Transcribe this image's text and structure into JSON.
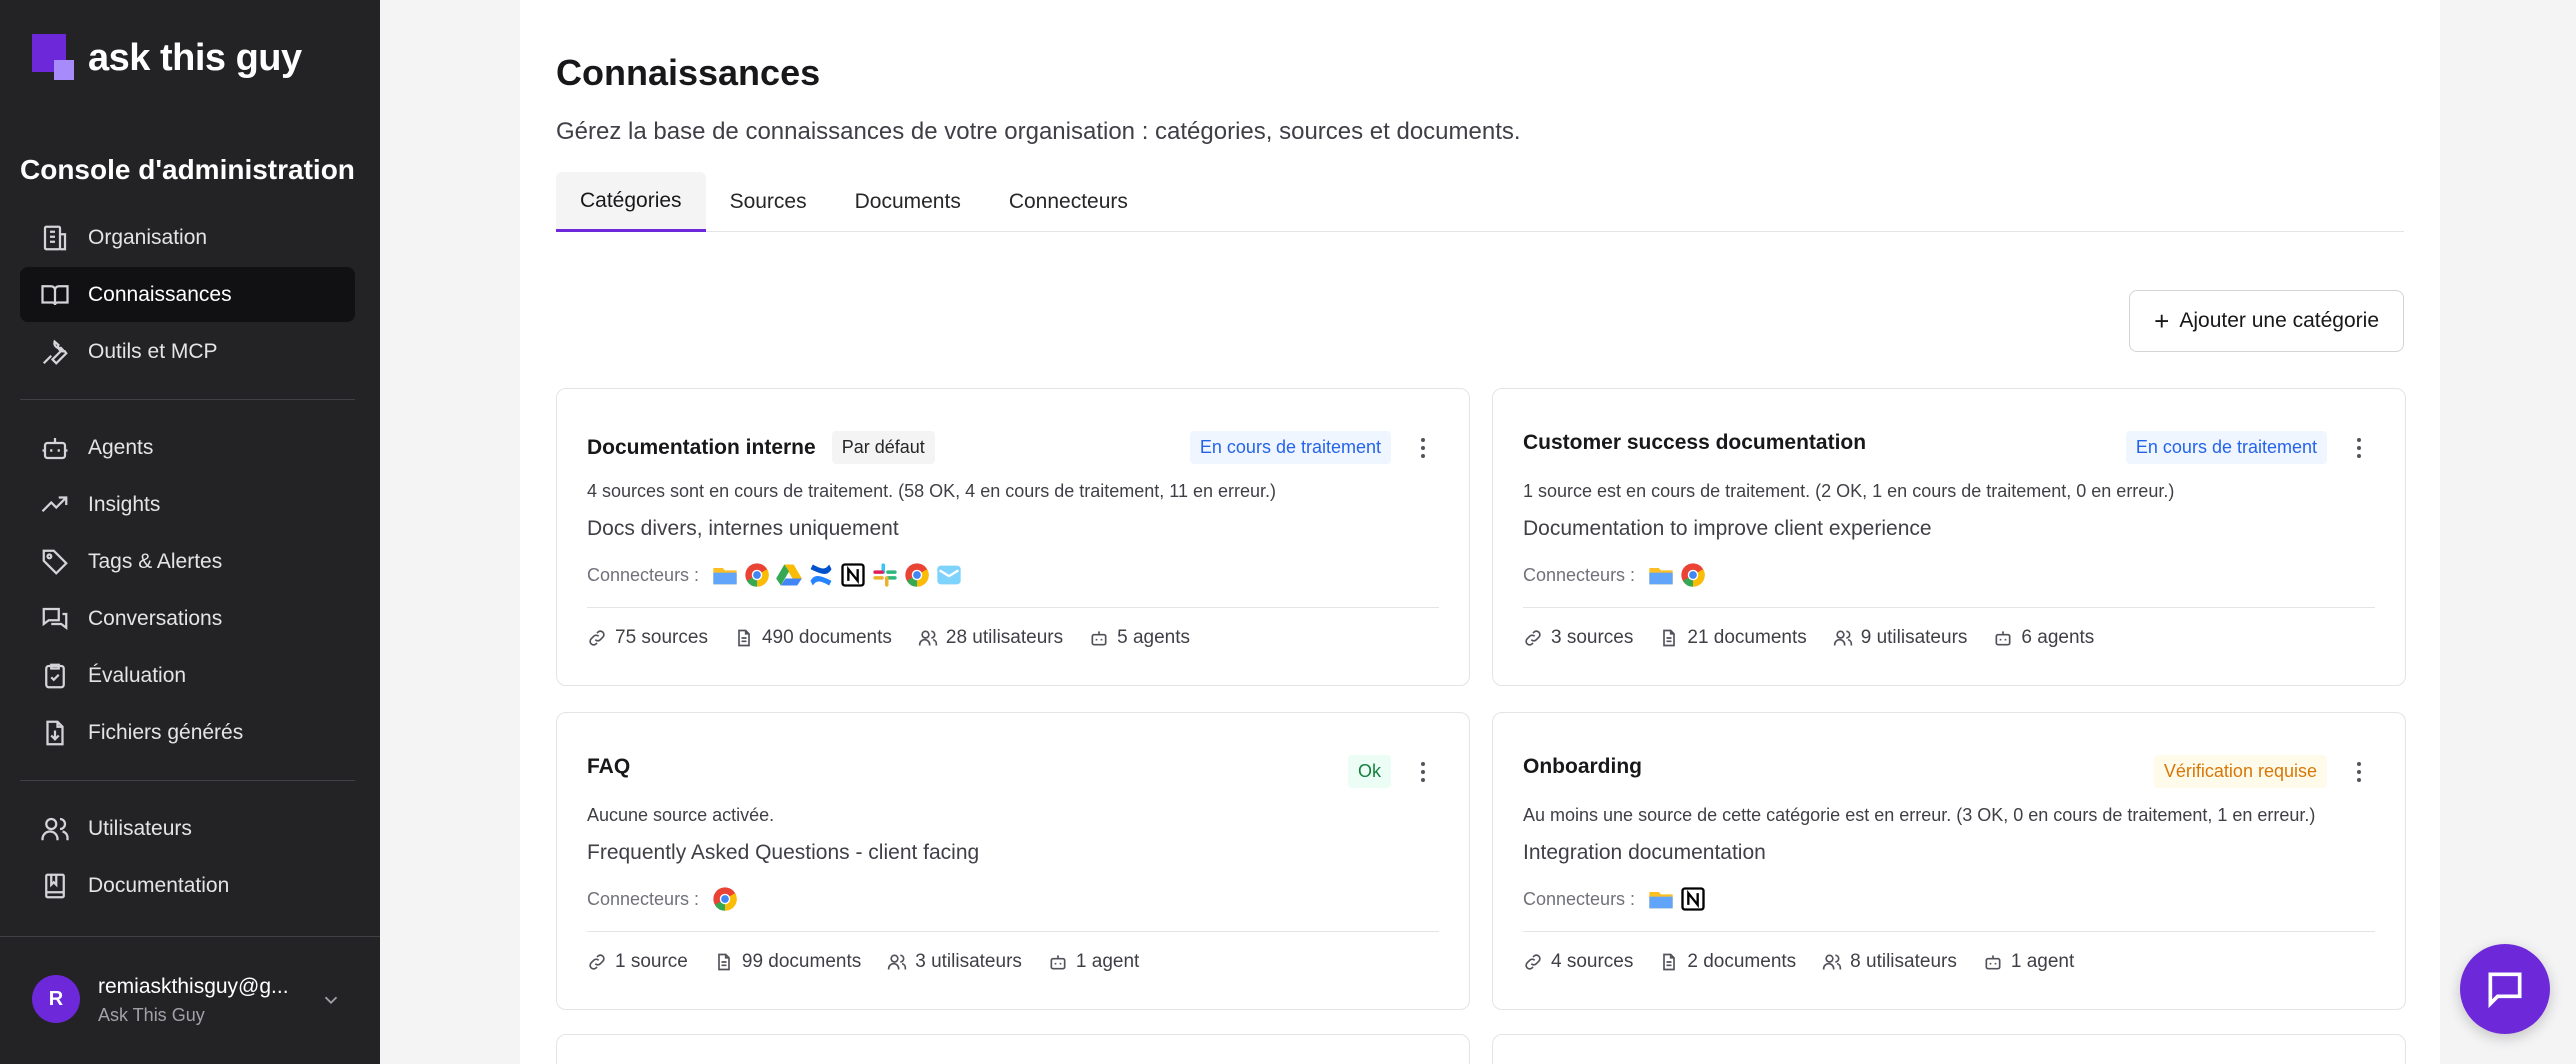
{
  "brand": {
    "name": "ask this guy"
  },
  "sidebar": {
    "console_title": "Console d'administration",
    "group1": [
      {
        "label": "Organisation",
        "icon": "building-icon"
      },
      {
        "label": "Connaissances",
        "icon": "book-icon",
        "active": true
      },
      {
        "label": "Outils et MCP",
        "icon": "wrench-icon"
      }
    ],
    "group2": [
      {
        "label": "Agents",
        "icon": "bot-icon"
      },
      {
        "label": "Insights",
        "icon": "trending-icon"
      },
      {
        "label": "Tags & Alertes",
        "icon": "tag-icon"
      },
      {
        "label": "Conversations",
        "icon": "chat-icon"
      },
      {
        "label": "Évaluation",
        "icon": "clipboard-icon"
      },
      {
        "label": "Fichiers générés",
        "icon": "file-download-icon"
      }
    ],
    "group3": [
      {
        "label": "Utilisateurs",
        "icon": "users-icon"
      },
      {
        "label": "Documentation",
        "icon": "notebook-icon"
      }
    ],
    "user": {
      "initial": "R",
      "email": "remiaskthisguy@g...",
      "org": "Ask This Guy"
    }
  },
  "main": {
    "title": "Connaissances",
    "subtitle": "Gérez la base de connaissances de votre organisation : catégories, sources et documents.",
    "tabs": [
      "Catégories",
      "Sources",
      "Documents",
      "Connecteurs"
    ],
    "add_button": "Ajouter une catégorie",
    "connectors_label": "Connecteurs :",
    "cards": [
      {
        "title": "Documentation interne",
        "default_badge": "Par défaut",
        "status": "En cours de traitement",
        "status_color": "#2563eb",
        "status_text": "4 sources sont en cours de traitement. (58 OK, 4 en cours de traitement, 11 en erreur.)",
        "description": "Docs divers, internes uniquement",
        "connectors": [
          "folder",
          "chrome",
          "drive",
          "confluence",
          "notion",
          "slack",
          "chrome",
          "mail"
        ],
        "sources": "75 sources",
        "documents": "490 documents",
        "users": "28 utilisateurs",
        "agents": "5 agents"
      },
      {
        "title": "Customer success documentation",
        "default_badge": "",
        "status": "En cours de traitement",
        "status_color": "#2563eb",
        "status_text": "1 source est en cours de traitement. (2 OK, 1 en cours de traitement, 0 en erreur.)",
        "description": "Documentation to improve client experience",
        "connectors": [
          "folder",
          "chrome"
        ],
        "sources": "3 sources",
        "documents": "21 documents",
        "users": "9 utilisateurs",
        "agents": "6 agents"
      },
      {
        "title": "FAQ",
        "default_badge": "",
        "status": "Ok",
        "status_color": "#15803d",
        "status_text": "Aucune source activée.",
        "description": "Frequently Asked Questions - client facing",
        "connectors": [
          "chrome"
        ],
        "sources": "1 source",
        "documents": "99 documents",
        "users": "3 utilisateurs",
        "agents": "1 agent"
      },
      {
        "title": "Onboarding",
        "default_badge": "",
        "status": "Vérification requise",
        "status_color": "#d97706",
        "status_text": "Au moins une source de cette catégorie est en erreur. (3 OK, 0 en cours de traitement, 1 en erreur.)",
        "description": "Integration documentation",
        "connectors": [
          "folder",
          "notion"
        ],
        "sources": "4 sources",
        "documents": "2 documents",
        "users": "8 utilisateurs",
        "agents": "1 agent"
      }
    ]
  }
}
